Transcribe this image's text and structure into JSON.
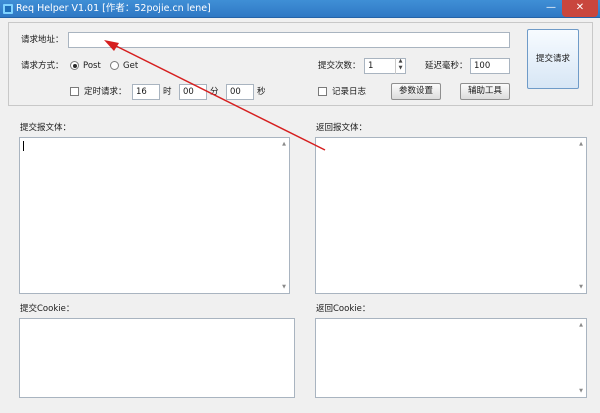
{
  "window": {
    "title": "Req Helper V1.01    [作者：52pojie.cn lene]",
    "minimize_glyph": "—",
    "close_glyph": "✕"
  },
  "request": {
    "url_label": "请求地址：",
    "url_value": "",
    "method_label": "请求方式：",
    "method_post": "Post",
    "method_get": "Get",
    "method_selected": "Post",
    "count_label": "提交次数：",
    "count_value": "1",
    "delay_label": "延迟毫秒：",
    "delay_value": "100",
    "timer_label": "定时请求：",
    "timer_hour": "16",
    "timer_hour_unit": "时",
    "timer_min": "00",
    "timer_min_unit": "分",
    "timer_sec": "00",
    "timer_sec_unit": "秒",
    "log_label": "记录日志",
    "params_button": "参数设置",
    "tools_button": "辅助工具",
    "submit_button": "提交请求"
  },
  "body": {
    "submit_body_label": "提交报文体：",
    "return_body_label": "返回报文体：",
    "submit_cookie_label": "提交Cookie：",
    "return_cookie_label": "返回Cookie："
  },
  "icons": {
    "app": "app-icon",
    "scroll_up": "scroll-up-icon",
    "scroll_down": "scroll-down-icon",
    "spin_up": "spin-up-icon",
    "spin_down": "spin-down-icon"
  },
  "colors": {
    "title_bar": "#3f8fd6",
    "close": "#c9463d",
    "arrow": "#d61f1f"
  }
}
